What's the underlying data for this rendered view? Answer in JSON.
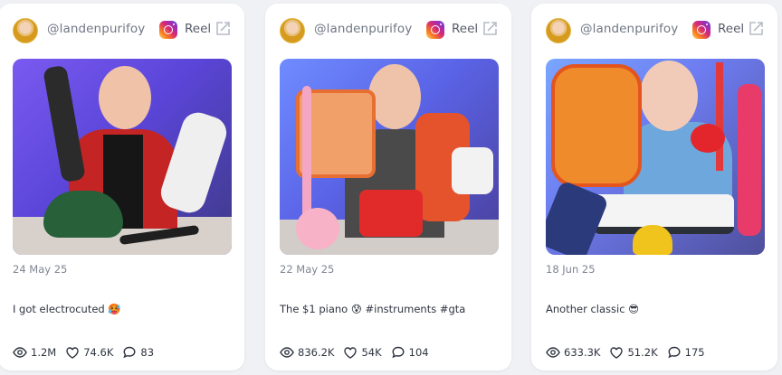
{
  "posts": [
    {
      "author": "@landenpurifoy",
      "platform": "Reel",
      "date": "24 May 25",
      "caption": "I got electrocuted 🥵",
      "views": "1.2M",
      "likes": "74.6K",
      "comments": "83"
    },
    {
      "author": "@landenpurifoy",
      "platform": "Reel",
      "date": "22 May 25",
      "caption": "The $1 piano 😰 #instruments #gta",
      "views": "836.2K",
      "likes": "54K",
      "comments": "104"
    },
    {
      "author": "@landenpurifoy",
      "platform": "Reel",
      "date": "18 Jun 25",
      "caption": "Another classic 😎",
      "views": "633.3K",
      "likes": "51.2K",
      "comments": "175"
    }
  ],
  "icons": {
    "platform": "instagram-icon",
    "external": "external-link-icon",
    "views": "eye-icon",
    "likes": "heart-icon",
    "comments": "comment-icon"
  }
}
